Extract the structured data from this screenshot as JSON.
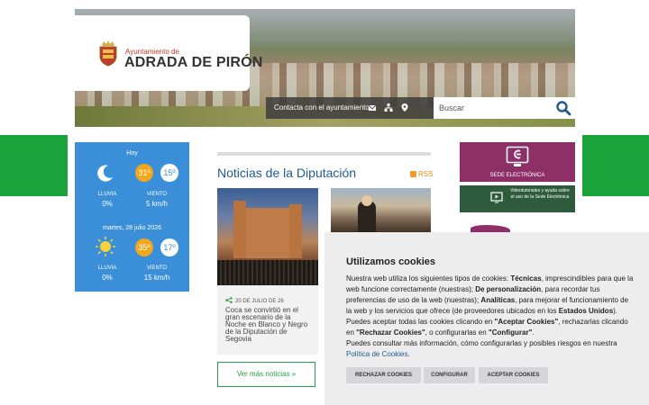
{
  "colors": {
    "accent_green": "#1aa33a",
    "weather_blue": "#3b8fd8",
    "sede_purple": "#8e2f68",
    "title_blue": "#1f5a8e"
  },
  "header": {
    "logo_small": "Ayuntamiento de",
    "logo_big": "ADRADA DE PIRÓN",
    "contact_label": "Contacta con el ayuntamiento:",
    "contact_icons": [
      "mail-icon",
      "sitemap-icon",
      "location-pin-icon"
    ],
    "search_placeholder": "Buscar"
  },
  "weather": {
    "days": [
      {
        "label": "Hoy",
        "icon": "moon-icon",
        "max": "31º",
        "min": "15º",
        "rain_label": "LLUVIA",
        "rain": "0%",
        "wind_label": "VIENTO",
        "wind": "5 km/h"
      },
      {
        "label": "martes, 28 julio 2026",
        "icon": "sun-icon",
        "max": "35º",
        "min": "17º",
        "rain_label": "LLUVIA",
        "rain": "0%",
        "wind_label": "VIENTO",
        "wind": "15 km/h"
      }
    ]
  },
  "news": {
    "title": "Noticias de la Diputación",
    "rss": "RSS",
    "item_date": "20 DE JULIO DE 26",
    "item_text": "Coca se convirtió en el gran escenario de la Noche en Blanco y Negro de la Diputación de Segovia",
    "more_label": "Ver más noticias  »"
  },
  "banners": {
    "sede_label": "SEDE ELECTRÓNICA",
    "video_label": "Videotutoriales y ayuda sobre el uso de la Sede Electrónica"
  },
  "cookies": {
    "title": "Utilizamos cookies",
    "p1_a": "Nuestra web utiliza los siguientes tipos de cookies: ",
    "p1_b": "Técnicas",
    "p1_c": ", imprescindibles para que la web funcione correctamente (nuestras); ",
    "p1_d": "De personalización",
    "p1_e": ", para recordar tus preferencias de uso de la web (nuestras); ",
    "p1_f": "Analíticas",
    "p1_g": ", para mejorar el funcionamiento de la web y los servicios que ofrece (de proveedores ubicados en los ",
    "p1_h": "Estados Unidos",
    "p1_i": ").",
    "p2_a": "Puedes aceptar todas las cookies clicando en ",
    "p2_b": "\"Aceptar Cookies\"",
    "p2_c": ", rechazarlas clicando en ",
    "p2_d": "\"Rechazar Cookies\"",
    "p2_e": ", o configurarlas en ",
    "p2_f": "\"Configurar\"",
    "p2_g": ".",
    "p3_a": "Puedes consultar más información, cómo configurarlas y posibles riesgos en nuestra ",
    "p3_link": "Política de Cookies",
    "p3_b": ".",
    "btn_reject": "RECHAZAR COOKIES",
    "btn_config": "CONFIGURAR",
    "btn_accept": "ACEPTAR COOKIES"
  }
}
